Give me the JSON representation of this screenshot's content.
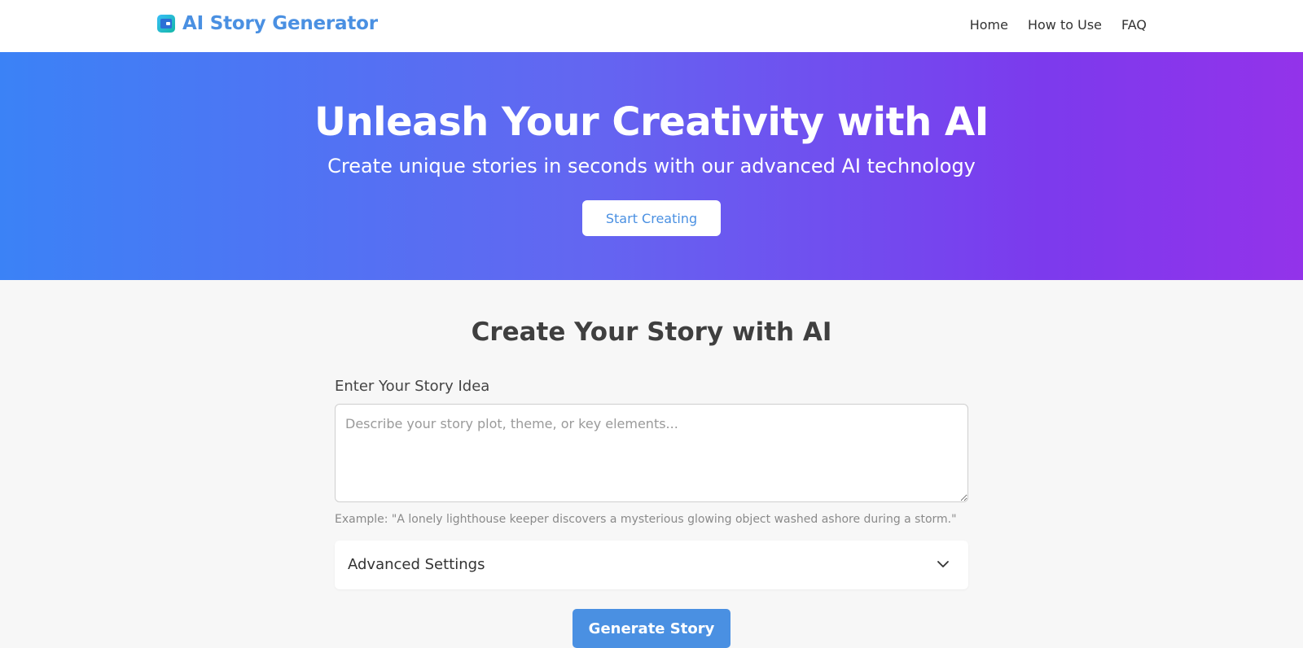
{
  "header": {
    "brand": "AI Story Generator",
    "nav": [
      "Home",
      "How to Use",
      "FAQ"
    ]
  },
  "hero": {
    "title": "Unleash Your Creativity with AI",
    "subtitle": "Create unique stories in seconds with our advanced AI technology",
    "cta_label": "Start Creating"
  },
  "main": {
    "title": "Create Your Story with AI",
    "story_label": "Enter Your Story Idea",
    "story_placeholder": "Describe your story plot, theme, or key elements...",
    "story_value": "",
    "example": "Example: \"A lonely lighthouse keeper discovers a mysterious glowing object washed ashore during a storm.\"",
    "advanced_label": "Advanced Settings",
    "generate_label": "Generate Story"
  },
  "colors": {
    "brand": "#4a90e2",
    "hero_gradient_start": "#3b82f6",
    "hero_gradient_end": "#9333ea",
    "page_background": "#f7f7f7"
  },
  "icons": {
    "brand": "app-logo-icon",
    "advanced_toggle": "chevron-down-icon"
  }
}
